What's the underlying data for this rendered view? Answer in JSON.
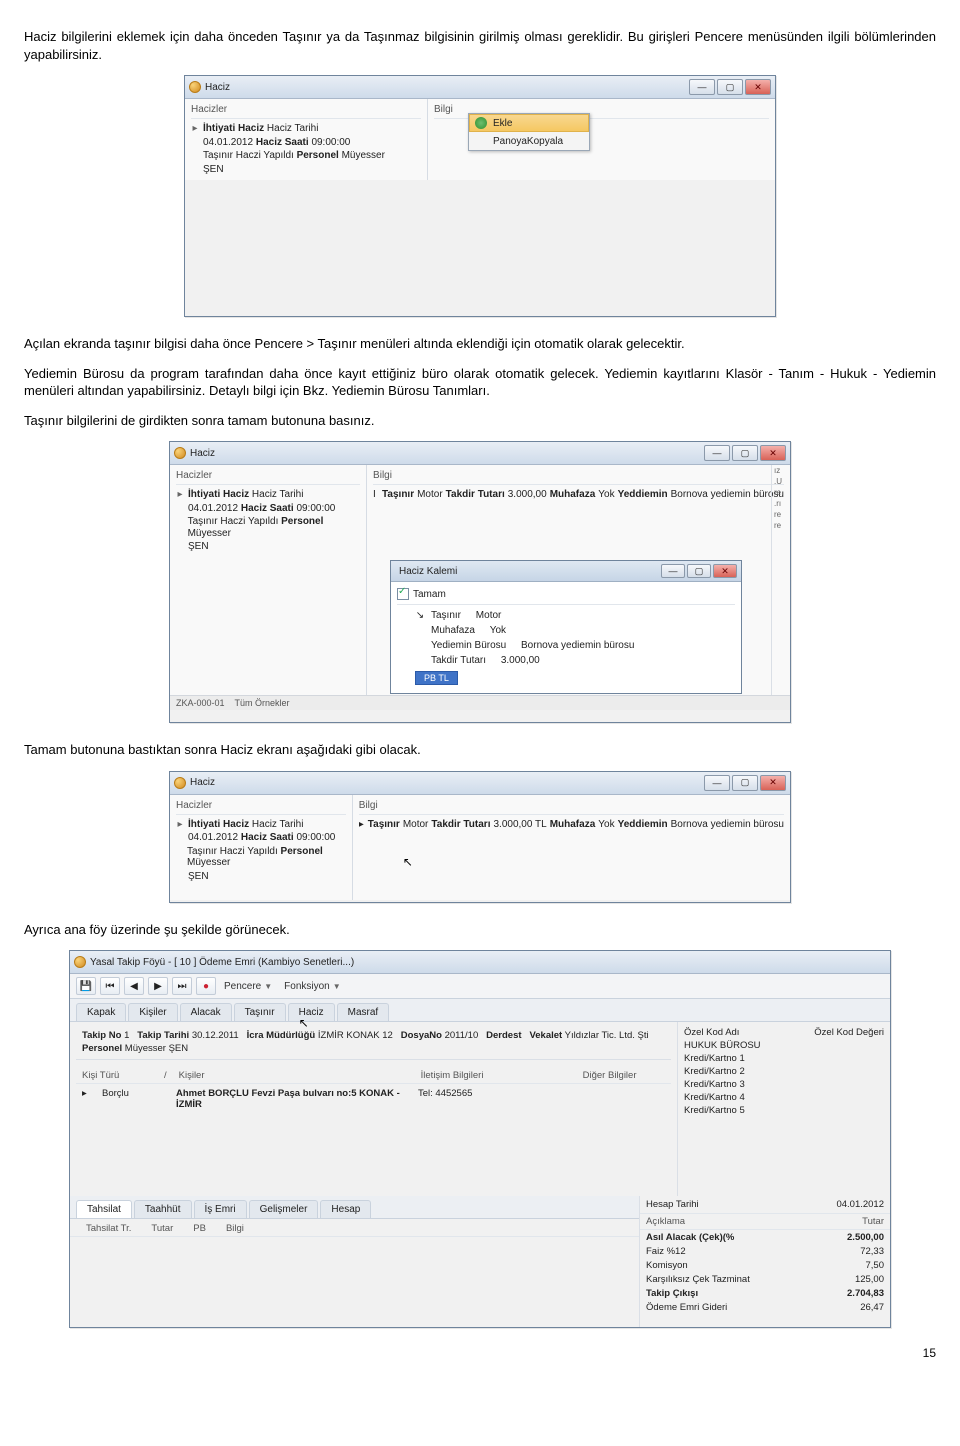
{
  "paragraphs": {
    "p1": "Haciz bilgilerini eklemek için daha önceden Taşınır ya da Taşınmaz bilgisinin girilmiş olması gereklidir. Bu girişleri Pencere menüsünden ilgili bölümlerinden yapabilirsiniz.",
    "p2": "Açılan ekranda taşınır bilgisi daha önce Pencere > Taşınır menüleri altında eklendiği için otomatik olarak gelecektir.",
    "p3": "Yediemin Bürosu da program tarafından daha önce kayıt ettiğiniz büro olarak otomatik gelecek. Yediemin kayıtlarını Klasör - Tanım - Hukuk - Yediemin menüleri altından yapabilirsiniz. Detaylı bilgi için Bkz. Yediemin Bürosu Tanımları.",
    "p4": "Taşınır bilgilerini de girdikten sonra tamam butonuna basınız.",
    "p5": "Tamam butonuna bastıktan sonra Haciz ekranı aşağıdaki gibi olacak.",
    "p6": "Ayrıca ana föy üzerinde şu şekilde görünecek."
  },
  "haciz_window": {
    "title": "Haciz",
    "left_header": "Hacizler",
    "right_header": "Bilgi",
    "tree": {
      "line1a": "İhtiyati Haciz",
      "line1b": "Haciz Tarihi",
      "line2a": "04.01.2012",
      "line2b": "Haciz Saati",
      "line2c": "09:00:00",
      "line3a": "Taşınır Haczi Yapıldı",
      "line3b": "Personel",
      "line3c": "Müyesser",
      "line4": "ŞEN"
    }
  },
  "context_menu": {
    "add": "Ekle",
    "copy": "PanoyaKopyala"
  },
  "haciz_kalemi": {
    "title": "Haciz Kalemi",
    "tamam": "Tamam",
    "rows": {
      "r1a": "Taşınır",
      "r1b": "Motor",
      "r2a": "Muhafaza",
      "r2b": "Yok",
      "r3a": "Yediemin Bürosu",
      "r3b": "Bornova yediemin bürosu",
      "r4a": "Takdir Tutarı",
      "r4b": "3.000,00",
      "pb": "PB  TL"
    }
  },
  "bilgi_line": {
    "l1": "Taşınır",
    "l2": "Motor",
    "l3": "Takdir Tutarı",
    "l4": "3.000,00",
    "l5": "Muhafaza",
    "l6": "Yok",
    "l7": "Yeddiemin",
    "l8": "Bornova yediemin bürosu"
  },
  "bilgi_line_tl": "3.000,00 TL",
  "footrow": {
    "a": "ZKA-000-01",
    "b": "Tüm Örnekler"
  },
  "foy": {
    "title": "Yasal Takip Föyü - [ 10 ] Ödeme Emri (Kambiyo Senetleri...)",
    "menu_pencere": "Pencere",
    "menu_fonksiyon": "Fonksiyon",
    "tabs1": [
      "Kapak",
      "Kişiler",
      "Alacak",
      "Taşınır",
      "Haciz",
      "Masraf"
    ],
    "infoline1": {
      "takipno_lbl": "Takip No",
      "takipno": "1",
      "takiptarihi_lbl": "Takip Tarihi",
      "takiptarihi": "30.12.2011",
      "icra_lbl": "İcra Müdürlüğü",
      "icra": "İZMİR KONAK 12",
      "dosyano_lbl": "DosyaNo",
      "dosyano": "2011/10",
      "derdest": "Derdest",
      "vekalet_lbl": "Vekalet",
      "vekalet": "Yıldızlar Tic. Ltd. Şti"
    },
    "infoline2": {
      "personel_lbl": "Personel",
      "personel": "Müyesser ŞEN"
    },
    "grid": {
      "col_turu": "Kişi Türü",
      "col_slash": "/",
      "col_kisiler": "Kişiler",
      "col_iletisim": "İletişim Bilgileri",
      "col_diger": "Diğer Bilgiler",
      "row_turu": "Borçlu",
      "row_kisi": "Ahmet BORÇLU Fevzi Paşa bulvarı no:5 KONAK - İZMİR",
      "row_ilet": "Tel: 4452565"
    },
    "right": {
      "ozelkodadi": "Özel Kod Adı",
      "ozelkoddeg": "Özel Kod Değeri",
      "hukuk": "HUKUK BÜROSU",
      "kk1": "Kredi/Kartno 1",
      "kk2": "Kredi/Kartno 2",
      "kk3": "Kredi/Kartno 3",
      "kk4": "Kredi/Kartno 4",
      "kk5": "Kredi/Kartno 5"
    },
    "tabs2": [
      "Tahsilat",
      "Taahhüt",
      "İş Emri",
      "Gelişmeler",
      "Hesap"
    ],
    "cols2": {
      "a": "Tahsilat Tr.",
      "b": "Tutar",
      "c": "PB",
      "d": "Bilgi"
    },
    "hesap": {
      "head_lbl": "Hesap Tarihi",
      "head_val": "04.01.2012",
      "c1": "Açıklama",
      "c2": "Tutar",
      "rows": [
        {
          "a": "Asıl Alacak (Çek)(%",
          "b": "2.500,00",
          "bold": true
        },
        {
          "a": "Faiz  %12",
          "b": "72,33"
        },
        {
          "a": "Komisyon",
          "b": "7,50"
        },
        {
          "a": "Karşılıksız Çek Tazminat",
          "b": "125,00"
        },
        {
          "a": "Takip Çıkışı",
          "b": "2.704,83",
          "bold": true
        },
        {
          "a": "Ödeme Emri Gideri",
          "b": "26,47"
        }
      ]
    }
  },
  "pagenum": "15"
}
